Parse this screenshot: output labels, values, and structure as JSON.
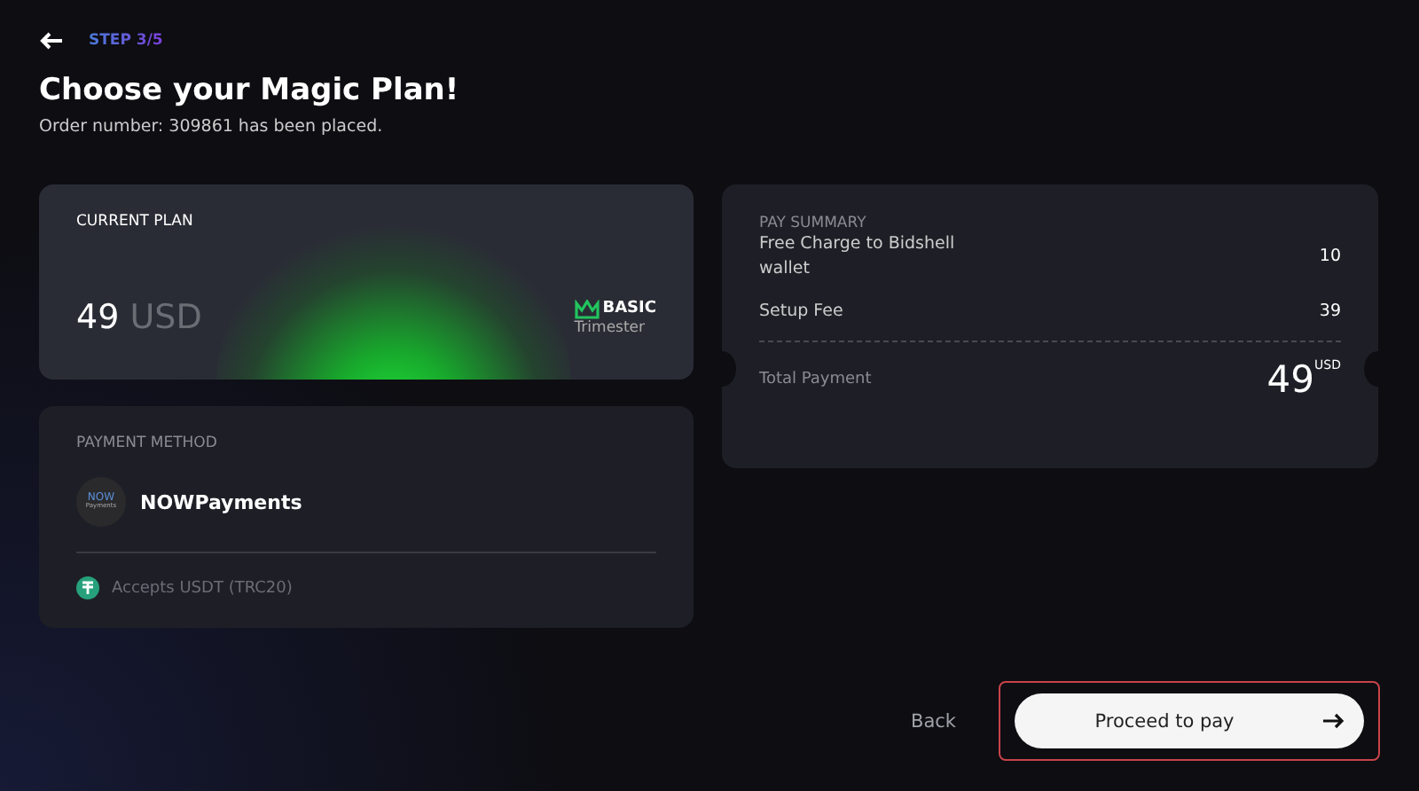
{
  "header": {
    "step": "STEP 3/5",
    "title": "Choose your Magic Plan!",
    "subtitle": "Order number: 309861 has been placed."
  },
  "current_plan": {
    "label": "CURRENT PLAN",
    "amount": "49",
    "currency": "USD",
    "tier": "BASIC",
    "period": "Trimester"
  },
  "payment_method": {
    "label": "PAYMENT METHOD",
    "logo_top": "NOW",
    "logo_bottom": "Payments",
    "name": "NOWPayments",
    "accepts": "Accepts USDT (TRC20)"
  },
  "pay_summary": {
    "label": "PAY SUMMARY",
    "items": [
      {
        "name": "Free Charge to Bidshell wallet",
        "value": "10"
      },
      {
        "name": "Setup Fee",
        "value": "39"
      }
    ],
    "total_label": "Total Payment",
    "total": "49",
    "total_currency": "USD"
  },
  "buttons": {
    "back": "Back",
    "proceed": "Proceed to pay",
    "proceed_focused": true
  }
}
